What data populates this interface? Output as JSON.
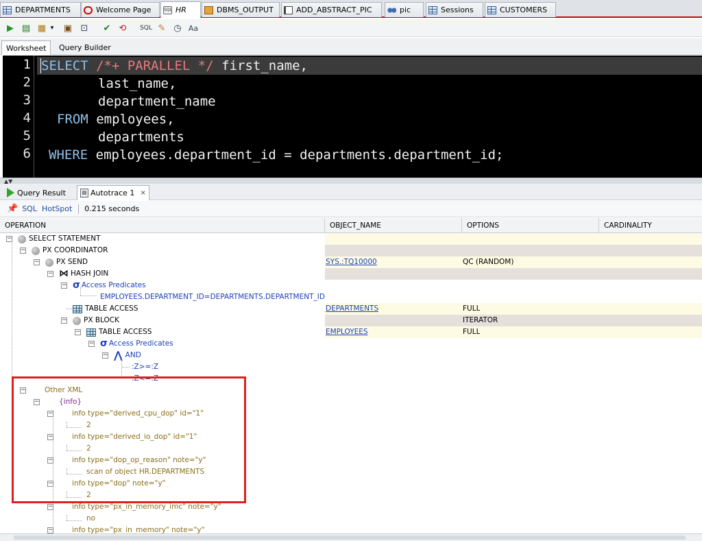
{
  "tabs": [
    {
      "label": "DEPARTMENTS",
      "icon": "table-grid-icon"
    },
    {
      "label": "Welcome Page",
      "icon": "oracle-logo-icon"
    },
    {
      "label": "HR",
      "icon": "sql-worksheet-icon"
    },
    {
      "label": "DBMS_OUTPUT",
      "icon": "package-icon"
    },
    {
      "label": "ADD_ABSTRACT_PIC",
      "icon": "procedure-icon"
    },
    {
      "label": "pic",
      "icon": "binoculars-icon"
    },
    {
      "label": "Sessions",
      "icon": "report-grid-icon"
    },
    {
      "label": "CUSTOMERS",
      "icon": "table-grid-icon"
    }
  ],
  "editor_tabs": {
    "worksheet": "Worksheet",
    "query_builder": "Query Builder"
  },
  "code": {
    "line_numbers": [
      "1",
      "2",
      "3",
      "4",
      "5",
      "6"
    ],
    "l1_kw": "SELECT",
    "l1_comment": "/*+ PARALLEL */",
    "l1_rest": "first_name,",
    "l2": "last_name,",
    "l3": "department_name",
    "l4_kw": "FROM",
    "l4_rest": "employees,",
    "l5": "departments",
    "l6_kw": "WHERE",
    "l6_rest": "employees.department_id = departments.department_id;"
  },
  "result_tabs": {
    "query_result": "Query Result",
    "autotrace": "Autotrace 1",
    "close": "×"
  },
  "status": {
    "sql": "SQL",
    "hotspot": "HotSpot",
    "time": "0.215 seconds"
  },
  "columns": {
    "operation": "OPERATION",
    "object_name": "OBJECT_NAME",
    "options": "OPTIONS",
    "cardinality": "CARDINALITY"
  },
  "plan": {
    "select_statement": "SELECT STATEMENT",
    "px_coordinator": "PX COORDINATOR",
    "px_send": "PX SEND",
    "px_send_object": "SYS.:TQ10000",
    "px_send_options": "QC (RANDOM)",
    "hash_join": "HASH JOIN",
    "access_predicates_1": "Access Predicates",
    "predicate_1": "EMPLOYEES.DEPARTMENT_ID=DEPARTMENTS.DEPARTMENT_ID",
    "table_access_1": "TABLE ACCESS",
    "table_access_1_object": "DEPARTMENTS",
    "table_access_1_options": "FULL",
    "px_block": "PX BLOCK",
    "px_block_options": "ITERATOR",
    "table_access_2": "TABLE ACCESS",
    "table_access_2_object": "EMPLOYEES",
    "table_access_2_options": "FULL",
    "access_predicates_2": "Access Predicates",
    "and": "AND",
    "z1": ":Z>=:Z",
    "z2": ":Z<=:Z",
    "other_xml": "Other XML",
    "info": "{info}",
    "info_1": "info type=\"derived_cpu_dop\" id=\"1\"",
    "info_1_val": "2",
    "info_2": "info type=\"derived_io_dop\" id=\"1\"",
    "info_2_val": "2",
    "info_3": "info type=\"dop_op_reason\" note=\"y\"",
    "info_3_val": "scan of object HR.DEPARTMENTS",
    "info_4": "info type=\"dop\" note=\"y\"",
    "info_4_val": "2",
    "info_5": "info type=\"px_in_memory_imc\" note=\"y\"",
    "info_5_val": "no",
    "info_6": "info type=\"px_in_memory\" note=\"y\""
  },
  "colors": {
    "highlight_box": "#e11d1d",
    "keyword": "#8ec1ea",
    "comment": "#e97a7a",
    "editor_bg": "#000000"
  }
}
